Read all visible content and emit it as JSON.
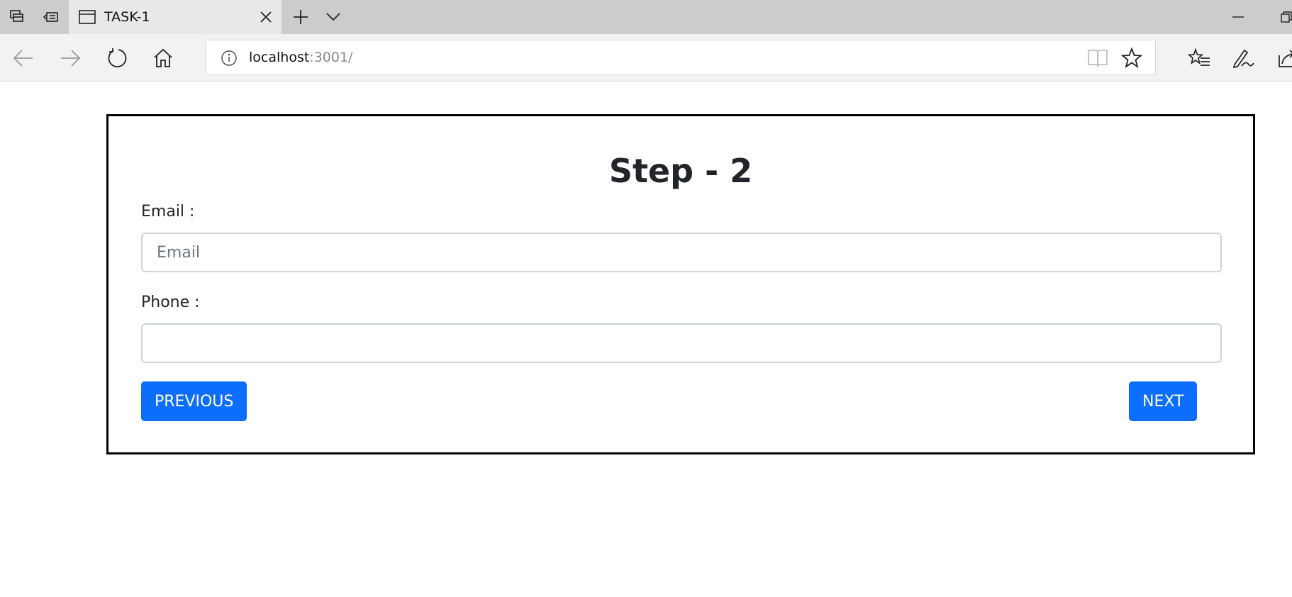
{
  "browser": {
    "tab_title": "TASK-1",
    "address": {
      "host": "localhost",
      "port_path": ":3001/"
    },
    "icons": {
      "tab_actions": [
        "tabs-aside-icon",
        "restore-tabs-icon"
      ],
      "nav": [
        "back-icon",
        "forward-icon",
        "refresh-icon",
        "home-icon"
      ],
      "address": [
        "info-icon",
        "reading-view-icon",
        "favorite-star-icon"
      ],
      "toolbar": [
        "favorites-hub-icon",
        "web-note-icon",
        "share-icon"
      ]
    }
  },
  "form": {
    "title": "Step - 2",
    "email": {
      "label": "Email :",
      "placeholder": "Email",
      "value": ""
    },
    "phone": {
      "label": "Phone :",
      "placeholder": "",
      "value": ""
    },
    "buttons": {
      "previous": "PREVIOUS",
      "next": "NEXT"
    },
    "colors": {
      "button": "#0d6efd",
      "card_border": "#000000"
    }
  }
}
